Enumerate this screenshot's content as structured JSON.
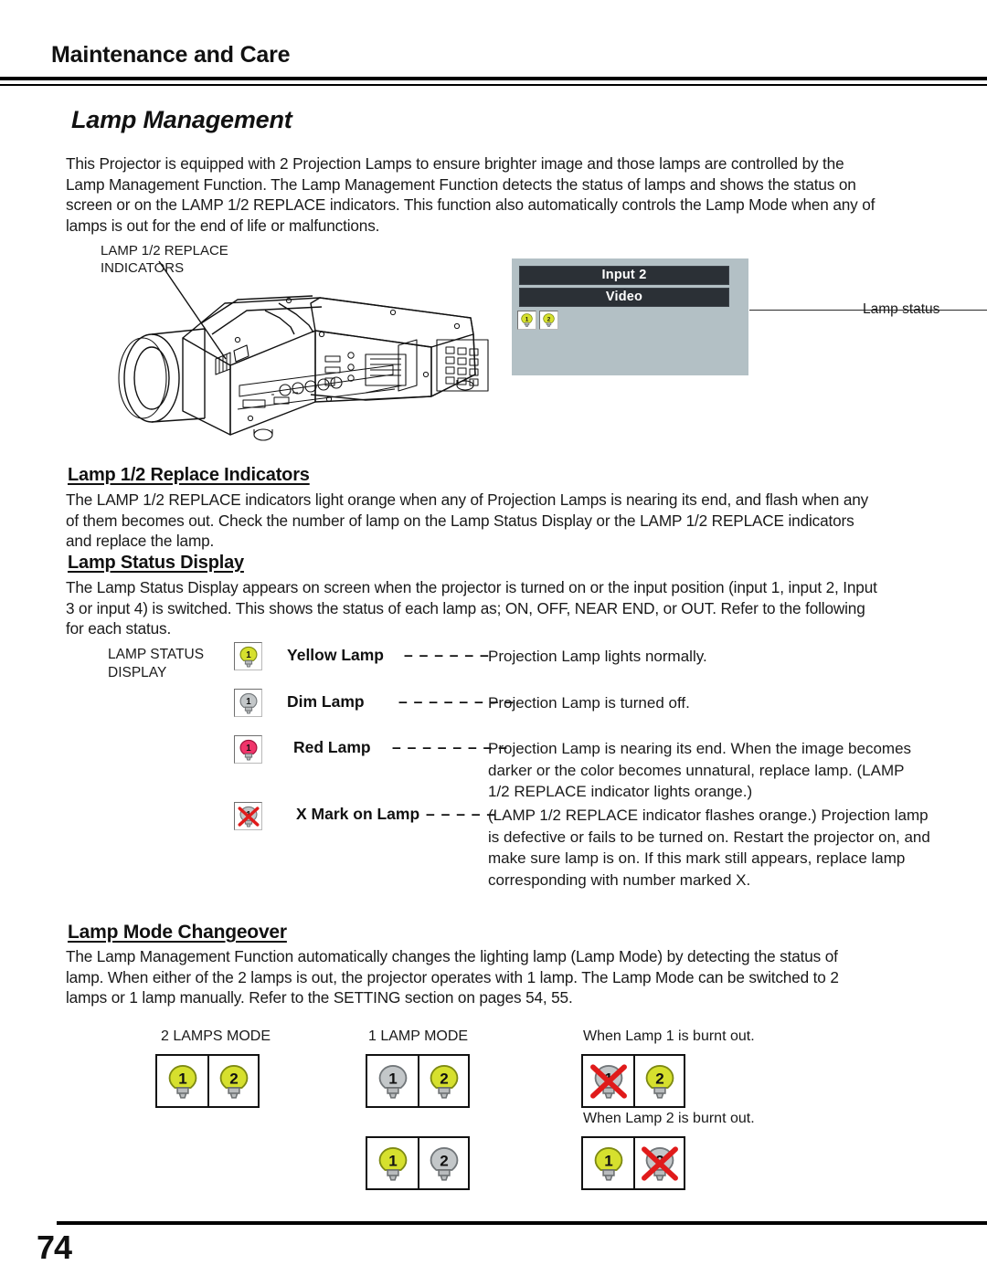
{
  "header": {
    "chapter": "Maintenance and Care",
    "section_title": "Lamp Management"
  },
  "intro": {
    "paragraph": "This Projector is equipped with 2 Projection Lamps to ensure brighter image and those lamps are controlled by the Lamp Management Function. The Lamp Management Function detects the status of lamps and shows the status on screen or on the LAMP 1/2 REPLACE indicators. This function also automatically controls the Lamp Mode when any of lamps is out for the end of life or malfunctions."
  },
  "figure": {
    "callout_label": "LAMP 1/2 REPLACE\nINDICATORS",
    "lamp_status_callout": "Lamp status",
    "osd": {
      "input_bar": "Input 2",
      "source_bar": "Video",
      "lamp_numbers": [
        "1",
        "2"
      ],
      "panel_color": "#b3c0c5",
      "bar_color": "#2b3036"
    }
  },
  "replace_section": {
    "heading": "Lamp 1/2 Replace Indicators",
    "paragraph": "The LAMP 1/2 REPLACE indicators light orange when any of Projection Lamps is nearing its end, and flash when any of them becomes out. Check the number of lamp on the Lamp Status Display or the LAMP 1/2 REPLACE indicators and replace the lamp."
  },
  "status_section": {
    "heading": "Lamp Status Display",
    "paragraph": "The Lamp Status Display appears on screen when the projector is turned on or the input position (input 1, input 2, Input 3 or input 4) is switched. This shows the status of each lamp as; ON, OFF, NEAR END, or OUT. Refer to the following for each status.",
    "caption": "LAMP STATUS\nDISPLAY",
    "rows": [
      {
        "term": "Yellow Lamp",
        "dashes": "– – – – – –",
        "description": "Projection Lamp lights normally.",
        "icon": "lamp-yellow-icon",
        "lamp_number": "1",
        "color": "#d6e02e"
      },
      {
        "term": "Dim Lamp",
        "dashes": "– – – – – – – –",
        "description": "Projection Lamp is turned off.",
        "icon": "lamp-dim-icon",
        "lamp_number": "1",
        "color": "#b9bcbe"
      },
      {
        "term": "Red Lamp",
        "dashes": "– – – – – – – –",
        "description": "Projection Lamp is nearing its end. When the image becomes darker or the color becomes unnatural, replace lamp. (LAMP 1/2 REPLACE indicator lights orange.)",
        "icon": "lamp-red-icon",
        "lamp_number": "1",
        "color": "#f0346a"
      },
      {
        "term": "X Mark on Lamp",
        "dashes": "– – – – –",
        "description": "(LAMP 1/2 REPLACE indicator flashes orange.) Projection lamp is defective or fails to be turned on. Restart the projector on, and make sure lamp is on. If this mark still appears, replace lamp corresponding with number marked X.",
        "icon": "lamp-x-mark-icon",
        "lamp_number": "1",
        "color": "#b9bcbe",
        "x_color": "#e01b1b"
      }
    ]
  },
  "mode_section": {
    "heading": "Lamp Mode Changeover",
    "paragraph": "The Lamp Management Function automatically changes the lighting lamp (Lamp Mode) by detecting the status of lamp. When either of the 2 lamps is out, the projector operates with 1 lamp. The Lamp Mode can be switched to 2 lamps or 1 lamp manually. Refer to the SETTING section on pages 54, 55.",
    "diagrams": [
      {
        "title": "2 LAMPS MODE",
        "cells": [
          {
            "lamp_number": "1",
            "state": "on"
          },
          {
            "lamp_number": "2",
            "state": "on"
          }
        ]
      },
      {
        "title": "1 LAMP MODE",
        "cells": [
          {
            "lamp_number": "1",
            "state": "off"
          },
          {
            "lamp_number": "2",
            "state": "on"
          }
        ]
      },
      {
        "title": "",
        "cells": [
          {
            "lamp_number": "1",
            "state": "on"
          },
          {
            "lamp_number": "2",
            "state": "off"
          }
        ]
      },
      {
        "title": "When Lamp 1 is burnt out.",
        "cells": [
          {
            "lamp_number": "1",
            "state": "x"
          },
          {
            "lamp_number": "2",
            "state": "on"
          }
        ]
      },
      {
        "title": "When Lamp 2 is burnt out.",
        "cells": [
          {
            "lamp_number": "1",
            "state": "on"
          },
          {
            "lamp_number": "2",
            "state": "x"
          }
        ]
      }
    ]
  },
  "footer": {
    "page_number": "74"
  }
}
